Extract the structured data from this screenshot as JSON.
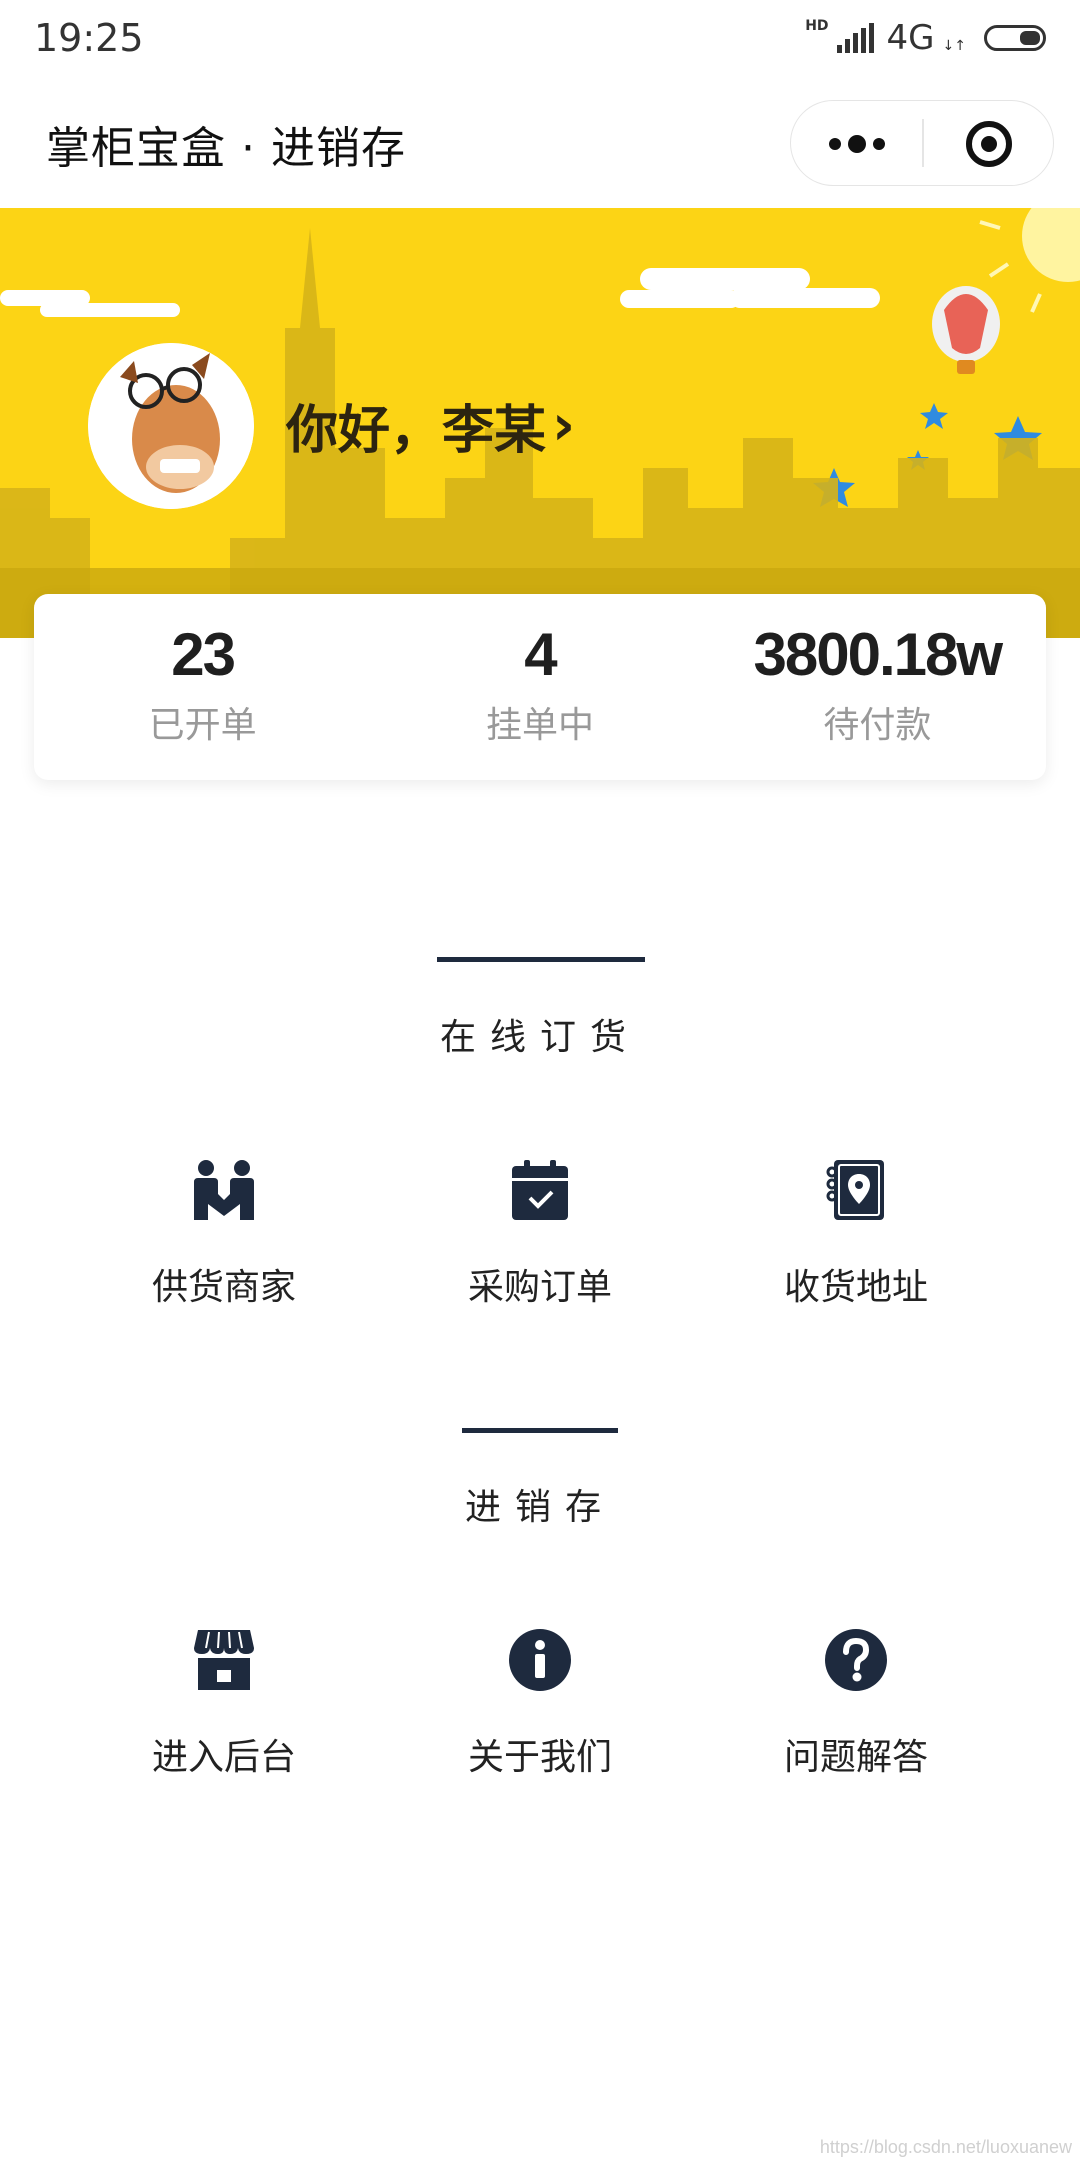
{
  "status_bar": {
    "time": "19:25",
    "hd": "HD",
    "network": "4G",
    "arrows": "↓↑"
  },
  "nav": {
    "title": "掌柜宝盒 · 进销存"
  },
  "banner": {
    "greeting": "你好，李某",
    "chevron": "›"
  },
  "stats": [
    {
      "value": "23",
      "label": "已开单"
    },
    {
      "value": "4",
      "label": "挂单中"
    },
    {
      "value": "3800.18w",
      "label": "待付款"
    }
  ],
  "section_online": {
    "title": "在线订货",
    "items": [
      {
        "label": "供货商家",
        "icon": "handshake-icon"
      },
      {
        "label": "采购订单",
        "icon": "calendar-check-icon"
      },
      {
        "label": "收货地址",
        "icon": "address-book-icon"
      }
    ]
  },
  "section_inventory": {
    "title": "进销存",
    "items": [
      {
        "label": "进入后台",
        "icon": "store-icon"
      },
      {
        "label": "关于我们",
        "icon": "info-icon"
      },
      {
        "label": "问题解答",
        "icon": "question-icon"
      }
    ]
  },
  "watermark": "https://blog.csdn.net/luoxuanew",
  "colors": {
    "banner": "#fcd415",
    "accent": "#1e2a3e"
  }
}
